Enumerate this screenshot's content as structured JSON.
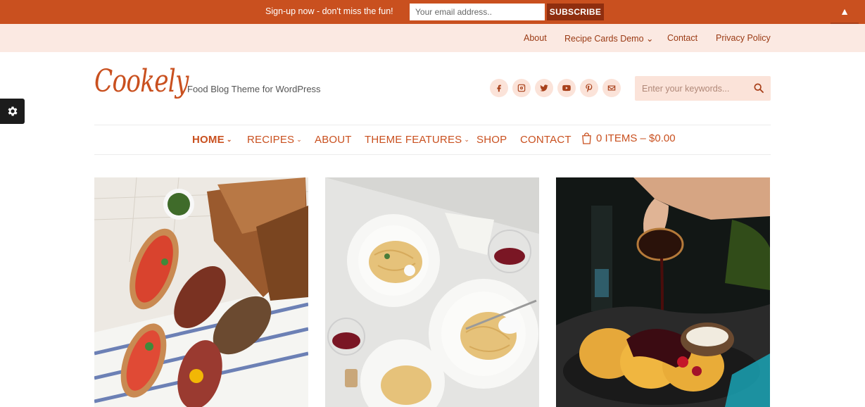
{
  "signup": {
    "text": "Sign-up now - don't miss the fun!",
    "email_placeholder": "Your email address..",
    "subscribe_label": "SUBSCRIBE",
    "collapse_glyph": "▲"
  },
  "utility_nav": {
    "items": [
      {
        "label": "About"
      },
      {
        "label": "Recipe Cards Demo ⌄"
      },
      {
        "label": "Contact"
      },
      {
        "label": "Privacy Policy"
      }
    ]
  },
  "header": {
    "logo": "Cookely",
    "tagline": "Food Blog Theme for WordPress",
    "social_icons": [
      "facebook-icon",
      "instagram-icon",
      "twitter-icon",
      "youtube-icon",
      "pinterest-icon",
      "email-icon"
    ],
    "search_placeholder": "Enter your keywords..."
  },
  "main_nav": {
    "items": [
      {
        "label": "HOME",
        "caret": "⌄"
      },
      {
        "label": "RECIPES",
        "caret": "⌄"
      },
      {
        "label": "ABOUT"
      },
      {
        "label": "THEME FEATURES",
        "caret": "⌄"
      },
      {
        "label": "SHOP"
      },
      {
        "label": "CONTACT"
      }
    ],
    "cart_label": "0 ITEMS – $0.00"
  },
  "cards": [
    {
      "image": "bruschetta-platter-photo"
    },
    {
      "image": "pasta-plates-photo"
    },
    {
      "image": "pancakes-syrup-photo"
    }
  ],
  "colors": {
    "accent": "#c9501f",
    "accent_dark": "#8f2e0f",
    "utility_bg": "#fbe9e2",
    "soft_pink": "#fbe3d9"
  }
}
